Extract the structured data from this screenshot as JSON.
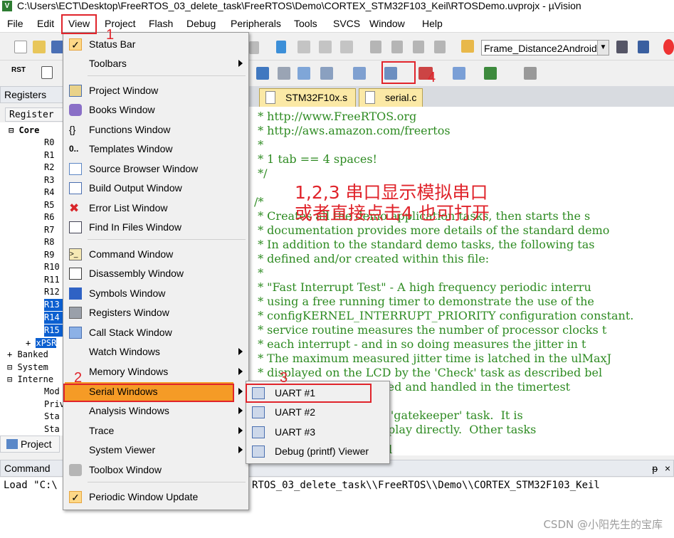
{
  "window": {
    "title": "C:\\Users\\ECT\\Desktop\\FreeRTOS_03_delete_task\\FreeRTOS\\Demo\\CORTEX_STM32F103_Keil\\RTOSDemo.uvprojx - µVision",
    "app_icon": "V"
  },
  "menubar": [
    "File",
    "Edit",
    "View",
    "Project",
    "Flash",
    "Debug",
    "Peripherals",
    "Tools",
    "SVCS",
    "Window",
    "Help"
  ],
  "toolbar": {
    "target_name": "Frame_Distance2Android",
    "rst_label": "RST"
  },
  "registers_panel": {
    "title": "Registers",
    "column": "Register",
    "tree": [
      "Core",
      "R0",
      "R1",
      "R2",
      "R3",
      "R4",
      "R5",
      "R6",
      "R7",
      "R8",
      "R9",
      "R10",
      "R11",
      "R12",
      "R13",
      "R14",
      "R15",
      "xPSR",
      "Banked",
      "System",
      "Interne",
      "Mod",
      "Priv",
      "Sta",
      "Sta"
    ],
    "tree_top": [
      "⊟",
      "+",
      "+",
      "⊟"
    ]
  },
  "project_tab": "Project",
  "editor": {
    "tabs": [
      "STM32F10x.s",
      "serial.c"
    ],
    "lines": [
      " * http://www.FreeRTOS.org",
      " * http://aws.amazon.com/freertos",
      " *",
      " * 1 tab == 4 spaces!",
      " */",
      "",
      "/*",
      " * Creates all the demo application tasks, then starts the s",
      " * documentation provides more details of the standard demo",
      " * In addition to the standard demo tasks, the following tas",
      " * defined and/or created within this file:",
      " *",
      " * \"Fast Interrupt Test\" - A high frequency periodic interru",
      " * using a free running timer to demonstrate the use of the",
      " * configKERNEL_INTERRUPT_PRIORITY configuration constant.",
      " * service routine measures the number of processor clocks t",
      " * each interrupt - and in so doing measures the jitter in t",
      " * The maximum measured jitter time is latched in the ulMaxJ",
      " * displayed on the LCD by the 'Check' task as described bel",
      " *                     configured and handled in the timertest",
      " *",
      " *                     task is a 'gatekeeper' task.  It is",
      " *                     s the display directly.  Other tasks",
      "                       displayed"
    ]
  },
  "command": {
    "title": "Command",
    "text": "Load \"C:\\",
    "text_right": "RTOS_03_delete_task\\\\FreeRTOS\\\\Demo\\\\CORTEX_STM32F103_Keil",
    "pin": "ᵽ",
    "close": "×"
  },
  "view_menu": {
    "items": [
      {
        "label": "Status Bar",
        "icon": "checkmark-icon"
      },
      {
        "label": "Toolbars",
        "submenu": true
      },
      {
        "label": "Project Window",
        "icon": "project-window-icon"
      },
      {
        "label": "Books Window",
        "icon": "books-icon"
      },
      {
        "label": "Functions Window",
        "icon": "functions-icon",
        "glyph": "{}"
      },
      {
        "label": "Templates Window",
        "icon": "templates-icon",
        "glyph": "0.."
      },
      {
        "label": "Source Browser Window",
        "icon": "source-browser-icon"
      },
      {
        "label": "Build Output Window",
        "icon": "build-output-icon"
      },
      {
        "label": "Error List Window",
        "icon": "error-icon",
        "glyph": "✖"
      },
      {
        "label": "Find In Files Window",
        "icon": "find-in-files-icon"
      },
      {
        "label": "Command Window",
        "icon": "command-icon",
        "glyph": ">_"
      },
      {
        "label": "Disassembly Window",
        "icon": "disassembly-icon"
      },
      {
        "label": "Symbols Window",
        "icon": "symbols-icon"
      },
      {
        "label": "Registers Window",
        "icon": "registers-icon"
      },
      {
        "label": "Call Stack Window",
        "icon": "call-stack-icon"
      },
      {
        "label": "Watch Windows",
        "submenu": true
      },
      {
        "label": "Memory Windows",
        "submenu": true
      },
      {
        "label": "Serial Windows",
        "submenu": true,
        "highlighted": true
      },
      {
        "label": "Analysis Windows",
        "submenu": true
      },
      {
        "label": "Trace",
        "submenu": true
      },
      {
        "label": "System Viewer",
        "submenu": true
      },
      {
        "label": "Toolbox Window",
        "icon": "toolbox-icon"
      },
      {
        "label": "Periodic Window Update",
        "icon": "checkmark-icon"
      }
    ]
  },
  "serial_submenu": [
    "UART #1",
    "UART #2",
    "UART #3",
    "Debug (printf) Viewer"
  ],
  "annotations": {
    "n1": "1",
    "n2": "2",
    "n3": "3",
    "n4": "4",
    "line1": "1,2,3 串口显示模拟串口",
    "line2": "或者直接点击4 也可打开"
  },
  "watermark": "CSDN @小阳先生的宝库",
  "colors": {
    "annotation": "#e0242b",
    "code_comment": "#2e8b22",
    "selection": "#0b5fd0",
    "menu_highlight": "#f59b26"
  }
}
